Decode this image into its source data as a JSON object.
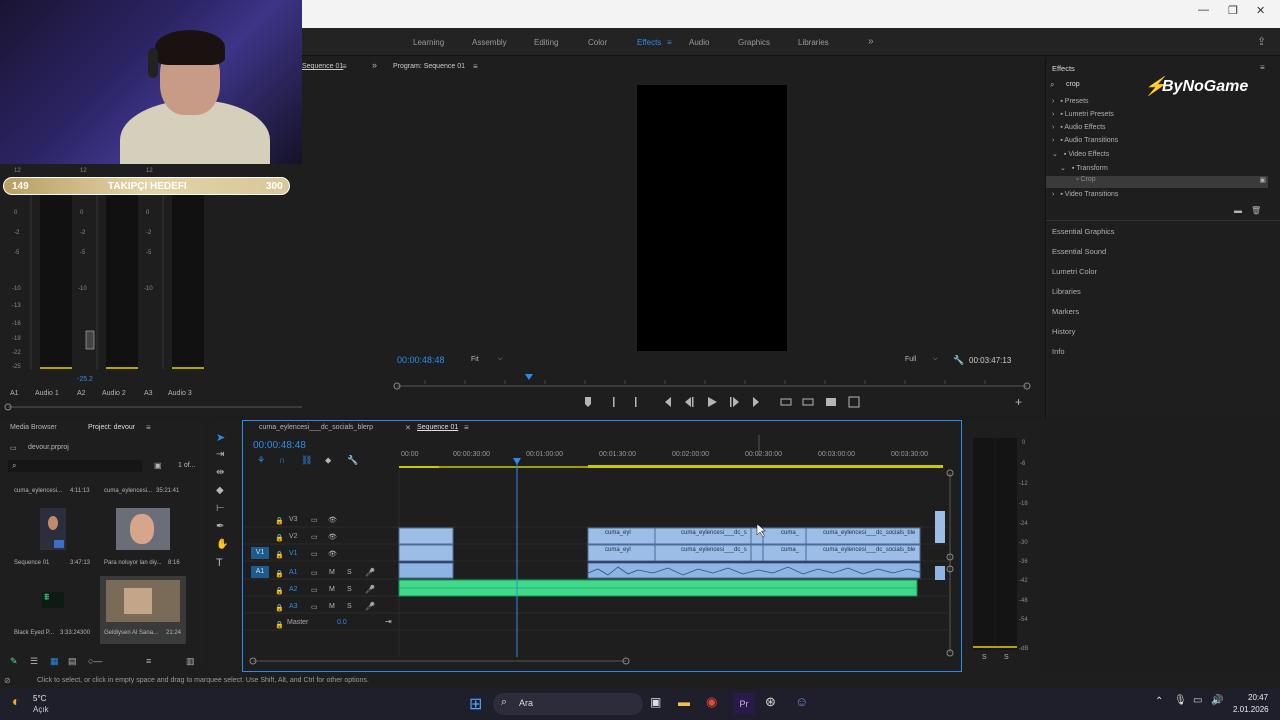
{
  "workspace": {
    "tabs": [
      "Learning",
      "Assembly",
      "Editing",
      "Color",
      "Effects",
      "Audio",
      "Graphics",
      "Libraries"
    ],
    "active_tab": "Effects"
  },
  "overlay": {
    "goal_current": "149",
    "goal_label": "TAKIPÇI HEDEFI",
    "goal_target": "300",
    "brand": "ByNoGame"
  },
  "mixer": {
    "labels": [
      "A1",
      "Audio 1",
      "A2",
      "Audio 2",
      "A3",
      "Audio 3"
    ],
    "level_readout": "-25.2",
    "scale": [
      "12",
      "12",
      "12",
      "6",
      "6",
      "6",
      "0",
      "0",
      "0",
      "-2",
      "-2",
      "-2",
      "-5",
      "-5",
      "-5",
      "-10",
      "-10",
      "-10",
      "-13",
      "-13",
      "-13",
      "-16",
      "-16",
      "-16",
      "-19",
      "-19",
      "-19",
      "-22",
      "-22",
      "-22",
      "-25",
      "-25",
      "-25",
      "-28",
      "-28",
      "-28",
      "-31",
      "-31",
      "-31",
      "-34",
      "-34",
      "-34",
      "-37",
      "-37",
      "-37"
    ],
    "source_tab": "Sequence 01"
  },
  "program": {
    "title": "Program: Sequence 01",
    "timecode": "00:00:48:48",
    "fit": "Fit",
    "quality": "Full",
    "duration": "00:03:47:13"
  },
  "effects_panel": {
    "title": "Effects",
    "search_value": "crop",
    "tree": [
      "Presets",
      "Lumetri Presets",
      "Audio Effects",
      "Audio Transitions",
      "Video Effects",
      "Transform",
      "Crop",
      "Video Transitions"
    ],
    "side": [
      "Essential Graphics",
      "Essential Sound",
      "Lumetri Color",
      "Libraries",
      "Markers",
      "History",
      "Info"
    ]
  },
  "project_panel": {
    "tabs": [
      "Media Browser",
      "Project: devour"
    ],
    "file": "devour.prproj",
    "count": "1 of...",
    "items": [
      {
        "name": "cuma_eylencesi...",
        "dur": "4:11:13"
      },
      {
        "name": "cuma_eylencesi...",
        "dur": "35:21:41"
      },
      {
        "name": "Sequence 01",
        "dur": "3:47:13"
      },
      {
        "name": "Para noluyor lan diy...",
        "dur": "8:16"
      },
      {
        "name": "Black Eyed P...",
        "dur": "3:33:24300"
      },
      {
        "name": "Geldiysen Al Sana...",
        "dur": "21:24"
      }
    ]
  },
  "timeline": {
    "tabs": [
      "cuma_eylencesi___dc_socials_blerp",
      "Sequence 01"
    ],
    "timecode": "00:00:48:48",
    "ticks": [
      "00:00",
      "00:00:30:00",
      "00:01:00:00",
      "00:01:30:00",
      "00:02:00:00",
      "00:02:30:00",
      "00:03:00:00",
      "00:03:30:00"
    ],
    "tracks": [
      "V3",
      "V2",
      "V1",
      "A1",
      "A2",
      "A3"
    ],
    "master": "Master",
    "master_value": "0.0",
    "clip_labels": [
      "cuma_eyl",
      "cuma_eylencesi___dc_s",
      "cuma_",
      "cuma_eylencesi___dc_socials_ble",
      "cuma_eyl",
      "cuma_eylencesi___dc_s",
      "cuma_",
      "cuma_eylencesi___dc_socials_ble"
    ]
  },
  "audio_meter": {
    "scale": [
      "0",
      "-6",
      "-12",
      "-18",
      "-24",
      "-30",
      "-36",
      "-42",
      "-48",
      "-54",
      "-dB"
    ],
    "solo": [
      "S",
      "S"
    ]
  },
  "status": {
    "message": "Click to select, or click in empty space and drag to marquee select. Use Shift, Alt, and Ctrl for other options."
  },
  "taskbar": {
    "weather_temp": "5°C",
    "weather_desc": "Açık",
    "search": "Ara",
    "time": "20:47",
    "date": "2.01.2026"
  }
}
